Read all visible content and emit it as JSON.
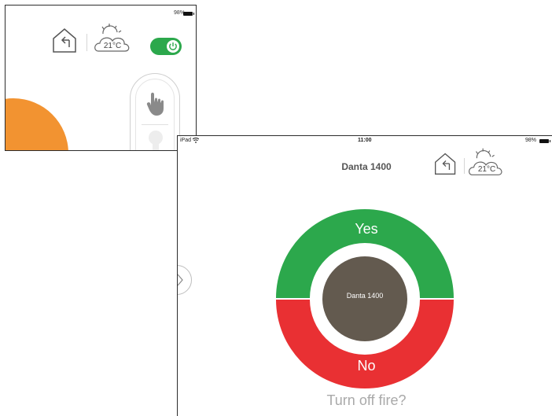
{
  "back_panel": {
    "battery_percent": "98%",
    "temperature": "21°C",
    "power_on": true,
    "icons": [
      "home-arrow-icon",
      "weather-cloud-sun-icon",
      "power-icon",
      "hand-pointer-icon",
      "lightbulb-icon"
    ]
  },
  "front_panel": {
    "status": {
      "device": "iPad",
      "time": "11:00",
      "battery": "98%"
    },
    "title": "Danta 1400",
    "temperature": "21°C",
    "dial": {
      "yes_label": "Yes",
      "no_label": "No",
      "center_label": "Danta 1400",
      "yes_color": "#2ca84c",
      "no_color": "#e93033",
      "center_color": "#635a4f"
    },
    "question": "Turn off fire?"
  }
}
